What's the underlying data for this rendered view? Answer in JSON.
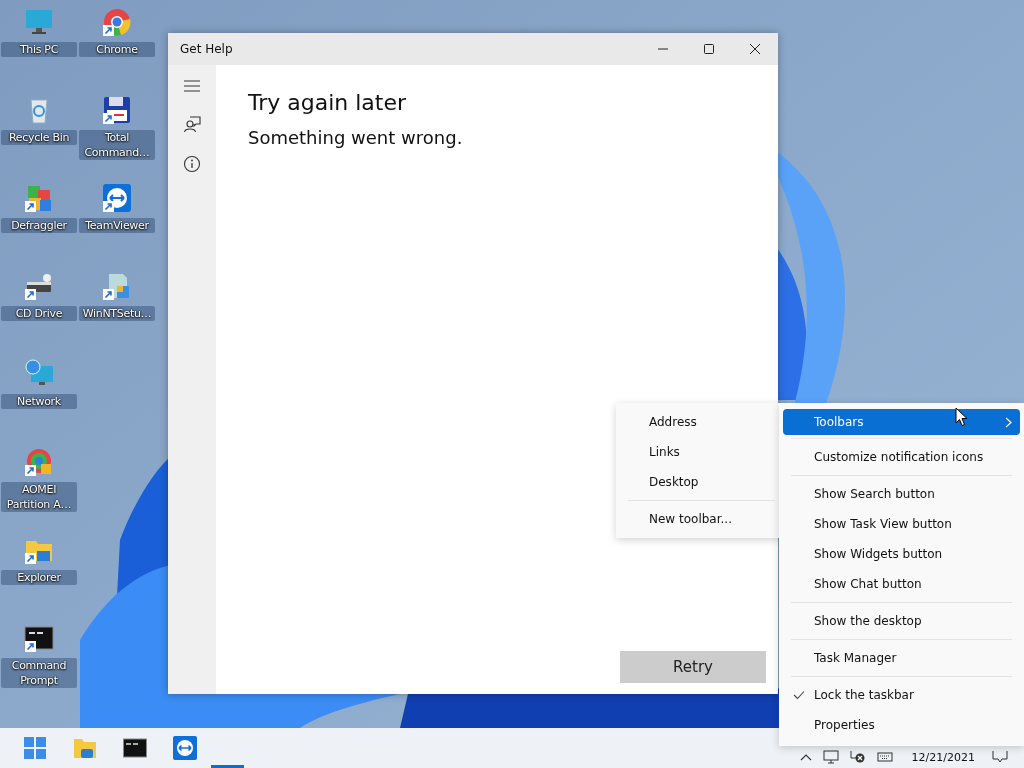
{
  "desktop_icons": [
    {
      "label": "This PC",
      "shortcut": false
    },
    {
      "label": "Recycle Bin",
      "shortcut": false
    },
    {
      "label": "Defraggler",
      "shortcut": true
    },
    {
      "label": "CD Drive",
      "shortcut": true
    },
    {
      "label": "Network",
      "shortcut": false
    },
    {
      "label": "AOMEI Partition A…",
      "shortcut": true
    },
    {
      "label": "Explorer",
      "shortcut": true
    },
    {
      "label": "Command Prompt",
      "shortcut": true
    },
    {
      "label": "Chrome",
      "shortcut": true
    },
    {
      "label": "Total Command…",
      "shortcut": true
    },
    {
      "label": "TeamViewer",
      "shortcut": true
    },
    {
      "label": "WinNTSetu…",
      "shortcut": true
    }
  ],
  "window": {
    "title": "Get Help",
    "heading": "Try again later",
    "message": "Something went wrong.",
    "button": "Retry"
  },
  "context_menu": {
    "sections": [
      [
        {
          "label": "Toolbars",
          "selected": true,
          "checked": false,
          "submenu": true
        }
      ],
      [
        {
          "label": "Customize notification icons",
          "selected": false,
          "checked": false,
          "submenu": false
        }
      ],
      [
        {
          "label": "Show Search button",
          "selected": false,
          "checked": false,
          "submenu": false
        },
        {
          "label": "Show Task View button",
          "selected": false,
          "checked": false,
          "submenu": false
        },
        {
          "label": "Show Widgets button",
          "selected": false,
          "checked": false,
          "submenu": false
        },
        {
          "label": "Show Chat button",
          "selected": false,
          "checked": false,
          "submenu": false
        }
      ],
      [
        {
          "label": "Show the desktop",
          "selected": false,
          "checked": false,
          "submenu": false
        }
      ],
      [
        {
          "label": "Task Manager",
          "selected": false,
          "checked": false,
          "submenu": false
        }
      ],
      [
        {
          "label": "Lock the taskbar",
          "selected": false,
          "checked": true,
          "submenu": false
        },
        {
          "label": "Properties",
          "selected": false,
          "checked": false,
          "submenu": false
        }
      ]
    ]
  },
  "submenu": {
    "sections": [
      [
        {
          "label": "Address"
        },
        {
          "label": "Links"
        },
        {
          "label": "Desktop"
        }
      ],
      [
        {
          "label": "New toolbar..."
        }
      ]
    ]
  },
  "taskbar": {
    "date": "12/21/2021"
  }
}
